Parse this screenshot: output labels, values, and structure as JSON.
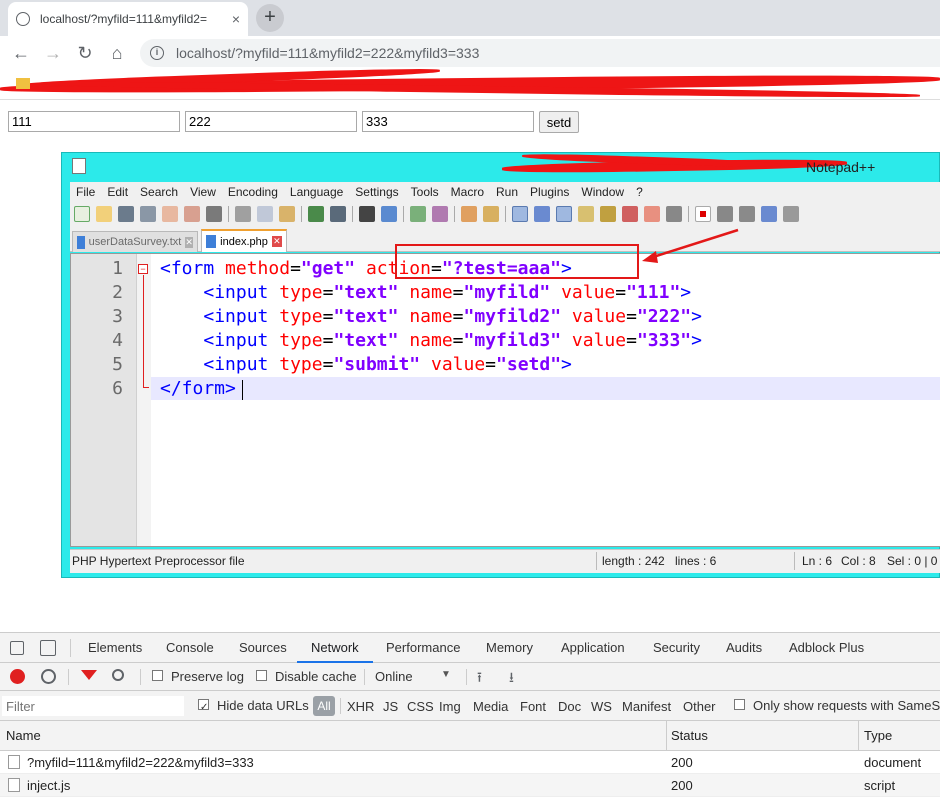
{
  "browser": {
    "tab_title": "localhost/?myfild=111&myfild2=",
    "tab_close": "×",
    "new_tab": "+",
    "back": "←",
    "forward": "→",
    "reload": "↻",
    "home": "⌂",
    "url": "localhost/?myfild=111&myfild2=222&myfild3=333"
  },
  "page_form": {
    "field1": "111",
    "field2": "222",
    "field3": "333",
    "submit": "setd"
  },
  "notepad": {
    "title": "Notepad++",
    "menu": [
      "File",
      "Edit",
      "Search",
      "View",
      "Encoding",
      "Language",
      "Settings",
      "Tools",
      "Macro",
      "Run",
      "Plugins",
      "Window",
      "?"
    ],
    "tabs": [
      "userDataSurvey.txt",
      "index.php"
    ],
    "active_tab": 1,
    "line_numbers": [
      "1",
      "2",
      "3",
      "4",
      "5",
      "6"
    ],
    "status": {
      "filetype": "PHP Hypertext Preprocessor file",
      "length": "length : 242",
      "lines": "lines : 6",
      "ln": "Ln : 6",
      "col": "Col : 8",
      "sel": "Sel : 0 | 0"
    }
  },
  "devtools": {
    "tabs": [
      "Elements",
      "Console",
      "Sources",
      "Network",
      "Performance",
      "Memory",
      "Application",
      "Security",
      "Audits",
      "Adblock Plus"
    ],
    "active_tab": "Network",
    "preserve_log": "Preserve log",
    "disable_cache": "Disable cache",
    "throttle": "Online",
    "filter_placeholder": "Filter",
    "hide_data_urls": "Hide data URLs",
    "all": "All",
    "types": [
      "XHR",
      "JS",
      "CSS",
      "Img",
      "Media",
      "Font",
      "Doc",
      "WS",
      "Manifest",
      "Other"
    ],
    "samesite": "Only show requests with SameSi",
    "columns": {
      "name": "Name",
      "status": "Status",
      "type": "Type"
    },
    "requests": [
      {
        "name": "?myfild=111&myfild2=222&myfild3=333",
        "status": "200",
        "type": "document"
      },
      {
        "name": "inject.js",
        "status": "200",
        "type": "script"
      }
    ]
  },
  "colors": {
    "npp_frame": "#2ceaea",
    "annotation_red": "#e31818",
    "tag_blue": "#0000ff",
    "attr_red": "#ff0000",
    "value_purple": "#8000ff"
  }
}
